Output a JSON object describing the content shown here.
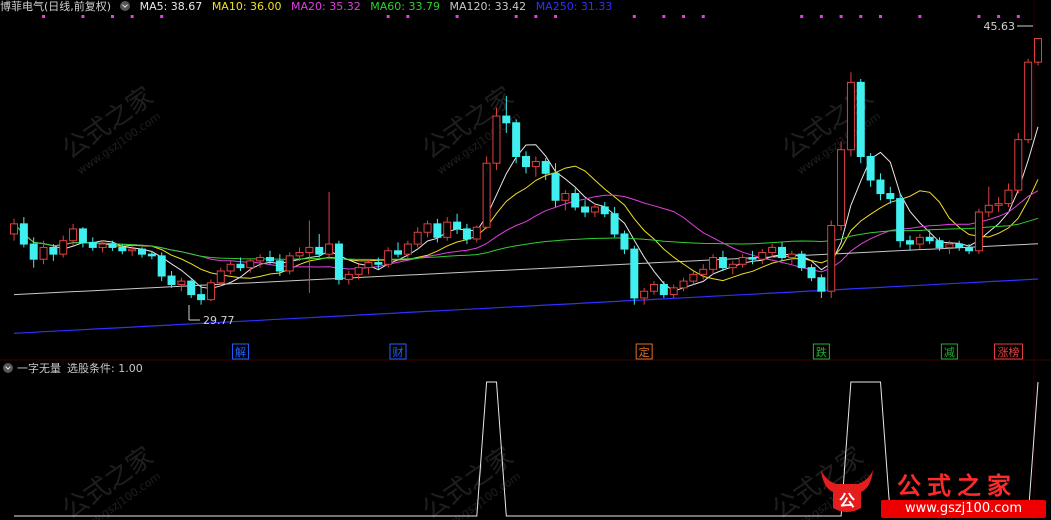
{
  "legend": {
    "stock_name": "博菲电气(日线,前复权)",
    "ma5": "MA5: 38.67",
    "ma10": "MA10: 36.00",
    "ma20": "MA20: 35.32",
    "ma60": "MA60: 33.79",
    "ma120": "MA120: 33.42",
    "ma250": "MA250: 31.33"
  },
  "colors": {
    "ma5": "#e8e8e8",
    "ma10": "#f0e020",
    "ma20": "#e040e0",
    "ma60": "#30d030",
    "ma120": "#c8c8c8",
    "ma250": "#3030ff",
    "up": "#e04040",
    "down": "#40f0f0"
  },
  "price_labels": {
    "high": "45.63",
    "low": "29.77"
  },
  "event_markers": [
    "解",
    "财",
    "定",
    "跌",
    "减",
    "涨榜"
  ],
  "indicator": {
    "name": "一字无量",
    "condition": "选股条件: 1.00"
  },
  "chart_data": [
    {
      "type": "candlestick",
      "title": "博菲电气(日线,前复权)",
      "high_label": 45.63,
      "low_label": 29.77,
      "ylim": [
        28,
        47
      ],
      "grid": false,
      "series": [
        {
          "name": "MA5",
          "last": 38.67
        },
        {
          "name": "MA10",
          "last": 36.0
        },
        {
          "name": "MA20",
          "last": 35.32
        },
        {
          "name": "MA60",
          "last": 33.79
        },
        {
          "name": "MA120",
          "last": 33.42
        },
        {
          "name": "MA250",
          "last": 31.33
        }
      ]
    },
    {
      "type": "line",
      "title": "一字无量",
      "ylim": [
        0,
        1
      ],
      "signal_value": 1.0
    }
  ],
  "watermark": {
    "text": "公式之家",
    "url": "www.gszj100.com"
  }
}
